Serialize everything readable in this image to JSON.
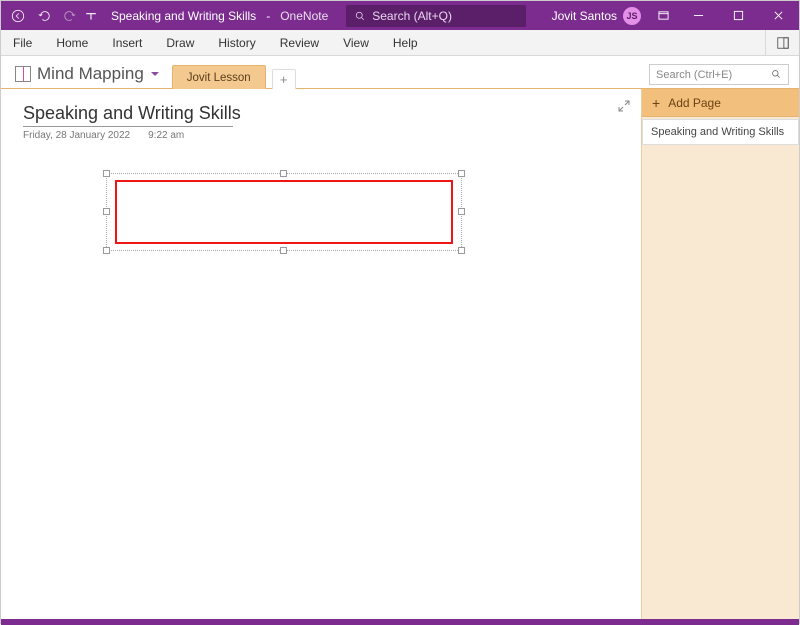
{
  "titlebar": {
    "doc_title": "Speaking and Writing Skills",
    "app_name": "OneNote",
    "search_placeholder": "Search (Alt+Q)",
    "user_name": "Jovit Santos",
    "user_initials": "JS"
  },
  "ribbon": {
    "tabs": [
      "File",
      "Home",
      "Insert",
      "Draw",
      "History",
      "Review",
      "View",
      "Help"
    ]
  },
  "notebook": {
    "name": "Mind Mapping",
    "section_tab": "Jovit Lesson",
    "page_search_placeholder": "Search (Ctrl+E)"
  },
  "page": {
    "title": "Speaking and Writing Skills",
    "date": "Friday, 28 January 2022",
    "time": "9:22 am"
  },
  "page_panel": {
    "add_label": "Add Page",
    "pages": [
      "Speaking and Writing Skills"
    ]
  }
}
